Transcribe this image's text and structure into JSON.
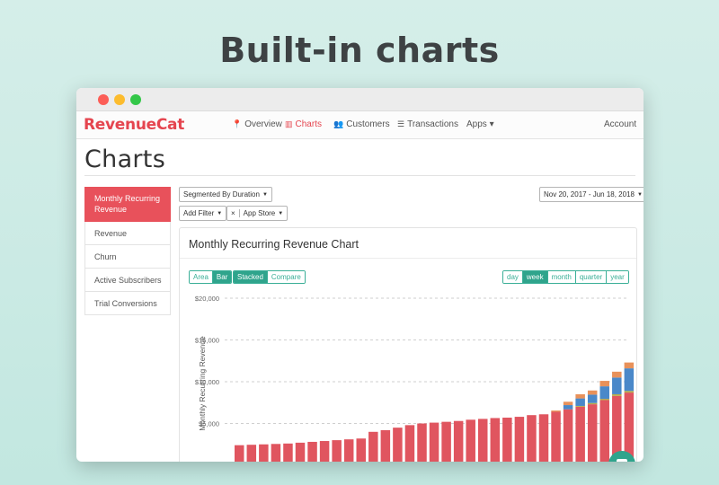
{
  "headline": "Built-in charts",
  "nav": {
    "logo": "RevenueCat",
    "items": [
      {
        "label": "Overview",
        "icon": "map-marker-icon"
      },
      {
        "label": "Charts",
        "icon": "bar-chart-icon"
      },
      {
        "label": "Customers",
        "icon": "users-icon"
      },
      {
        "label": "Transactions",
        "icon": "list-icon"
      },
      {
        "label": "Apps ▾",
        "icon": ""
      },
      {
        "label": "Account",
        "icon": ""
      }
    ]
  },
  "page": {
    "title": "Charts"
  },
  "sidebar": {
    "items": [
      {
        "label": "Monthly Recurring Revenue",
        "active": true
      },
      {
        "label": "Revenue"
      },
      {
        "label": "Churn"
      },
      {
        "label": "Active Subscribers"
      },
      {
        "label": "Trial Conversions"
      }
    ]
  },
  "filters": {
    "segment": "Segmented By Duration",
    "add_filter": "Add Filter",
    "remove": "×",
    "store": "App Store",
    "date_range": "Nov 20, 2017 - Jun 18, 2018"
  },
  "panel": {
    "title": "Monthly Recurring Revenue Chart",
    "chart_types": [
      "Area",
      "Bar"
    ],
    "chart_type_selected": "Bar",
    "modes": [
      "Stacked",
      "Compare"
    ],
    "mode_selected": "Stacked",
    "periods": [
      "day",
      "week",
      "month",
      "quarter",
      "year"
    ],
    "period_selected": "week"
  },
  "colors": {
    "brand": "#e5454f",
    "accent": "#2fa48c",
    "red": "#e0555f",
    "blue": "#4a88c9",
    "olive": "#b6ac4a",
    "orange": "#e8915a"
  },
  "chart_data": {
    "type": "bar",
    "stacked": true,
    "ylabel": "Monthly Recurring Revenue",
    "yticks": [
      "$20,000",
      "$15,000",
      "$10,000",
      "$5,000"
    ],
    "ylim": [
      0,
      20000
    ],
    "grid": true,
    "legend": "none",
    "series": [
      {
        "values": [
          2400,
          2450,
          2500,
          2550,
          2600,
          2700,
          2800,
          2900,
          3000,
          3100,
          3200,
          4000,
          4200,
          4500,
          4800,
          5000,
          5100,
          5200,
          5300,
          5450,
          5550,
          5650,
          5700,
          5800,
          6000,
          6100,
          6400,
          6700,
          7000,
          7300,
          7800,
          8300,
          8700,
          9400,
          10200,
          11100,
          12400,
          13500
        ]
      },
      {
        "values": [
          0,
          0,
          0,
          0,
          0,
          0,
          0,
          0,
          0,
          0,
          0,
          0,
          0,
          0,
          0,
          0,
          0,
          0,
          0,
          0,
          0,
          0,
          0,
          0,
          0,
          0,
          0,
          0,
          100,
          150,
          150,
          200,
          200,
          200,
          250,
          250,
          250,
          250
        ]
      },
      {
        "values": [
          0,
          0,
          0,
          0,
          0,
          0,
          0,
          0,
          0,
          0,
          0,
          0,
          0,
          0,
          0,
          0,
          0,
          0,
          0,
          0,
          0,
          0,
          0,
          0,
          0,
          0,
          0,
          500,
          900,
          1000,
          1500,
          2000,
          2700,
          3700,
          4400,
          4800,
          4700,
          5200
        ]
      },
      {
        "values": [
          0,
          0,
          0,
          0,
          0,
          0,
          0,
          0,
          0,
          0,
          0,
          0,
          0,
          0,
          0,
          0,
          0,
          0,
          0,
          0,
          0,
          0,
          0,
          0,
          0,
          0,
          150,
          400,
          500,
          500,
          650,
          700,
          700,
          800,
          900,
          900,
          1000,
          1100
        ]
      }
    ]
  }
}
